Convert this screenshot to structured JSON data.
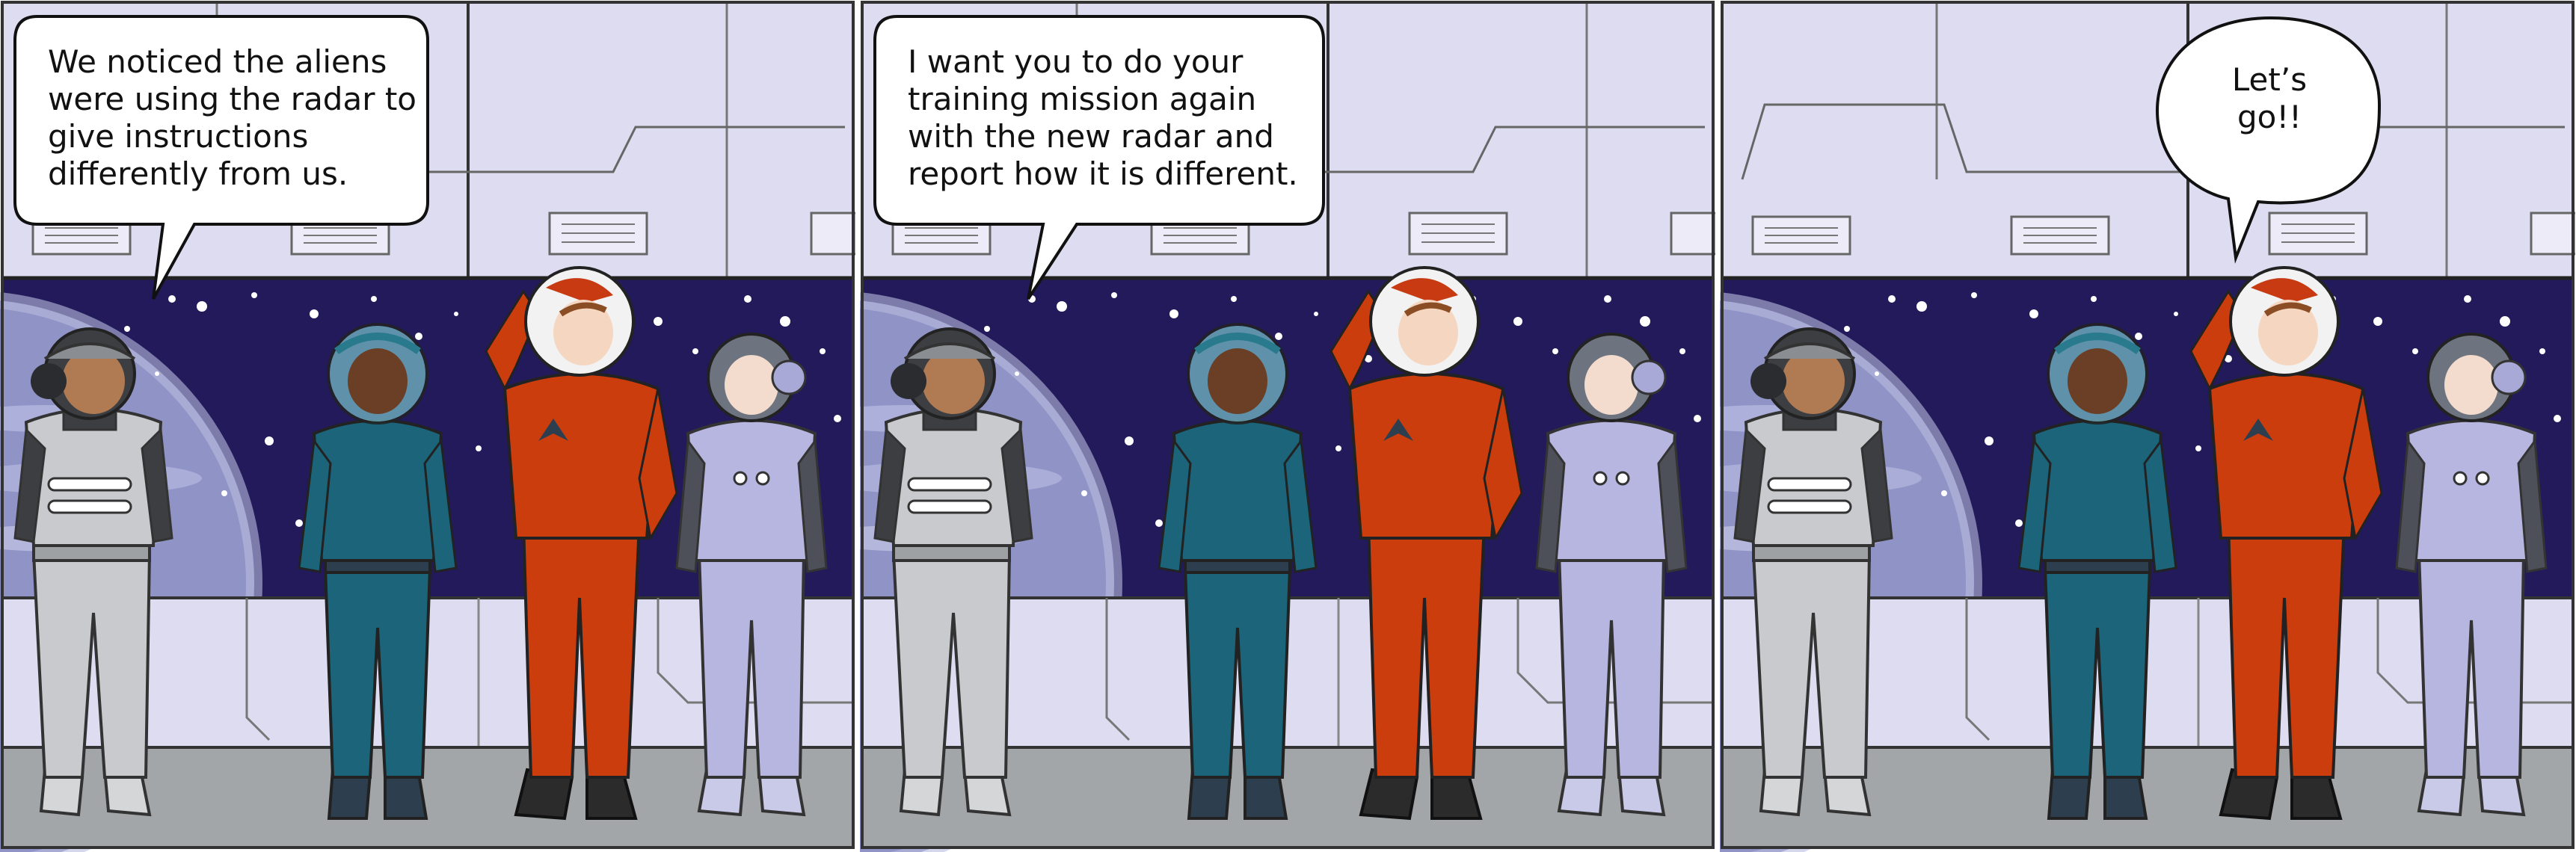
{
  "panels": [
    {
      "speech": "We noticed the aliens\nwere using the radar to\ngive instructions\ndifferently from us.",
      "speaker": "gray-suit-character"
    },
    {
      "speech": "I want you to do your\ntraining mission again\nwith the new radar and\nreport how it is different.",
      "speaker": "gray-suit-character"
    },
    {
      "speech": "Let’s\ngo!!",
      "speaker": "orange-suit-character"
    }
  ],
  "colors": {
    "wall": "#dedcf0",
    "space": "#231a5b",
    "planet": "#8f93c6",
    "floor": "#a3a6a9",
    "gray_suit": "#c8cacd",
    "teal_suit": "#1b6479",
    "orange_suit": "#cc3d0e",
    "lavender_suit": "#b6b6e0"
  }
}
